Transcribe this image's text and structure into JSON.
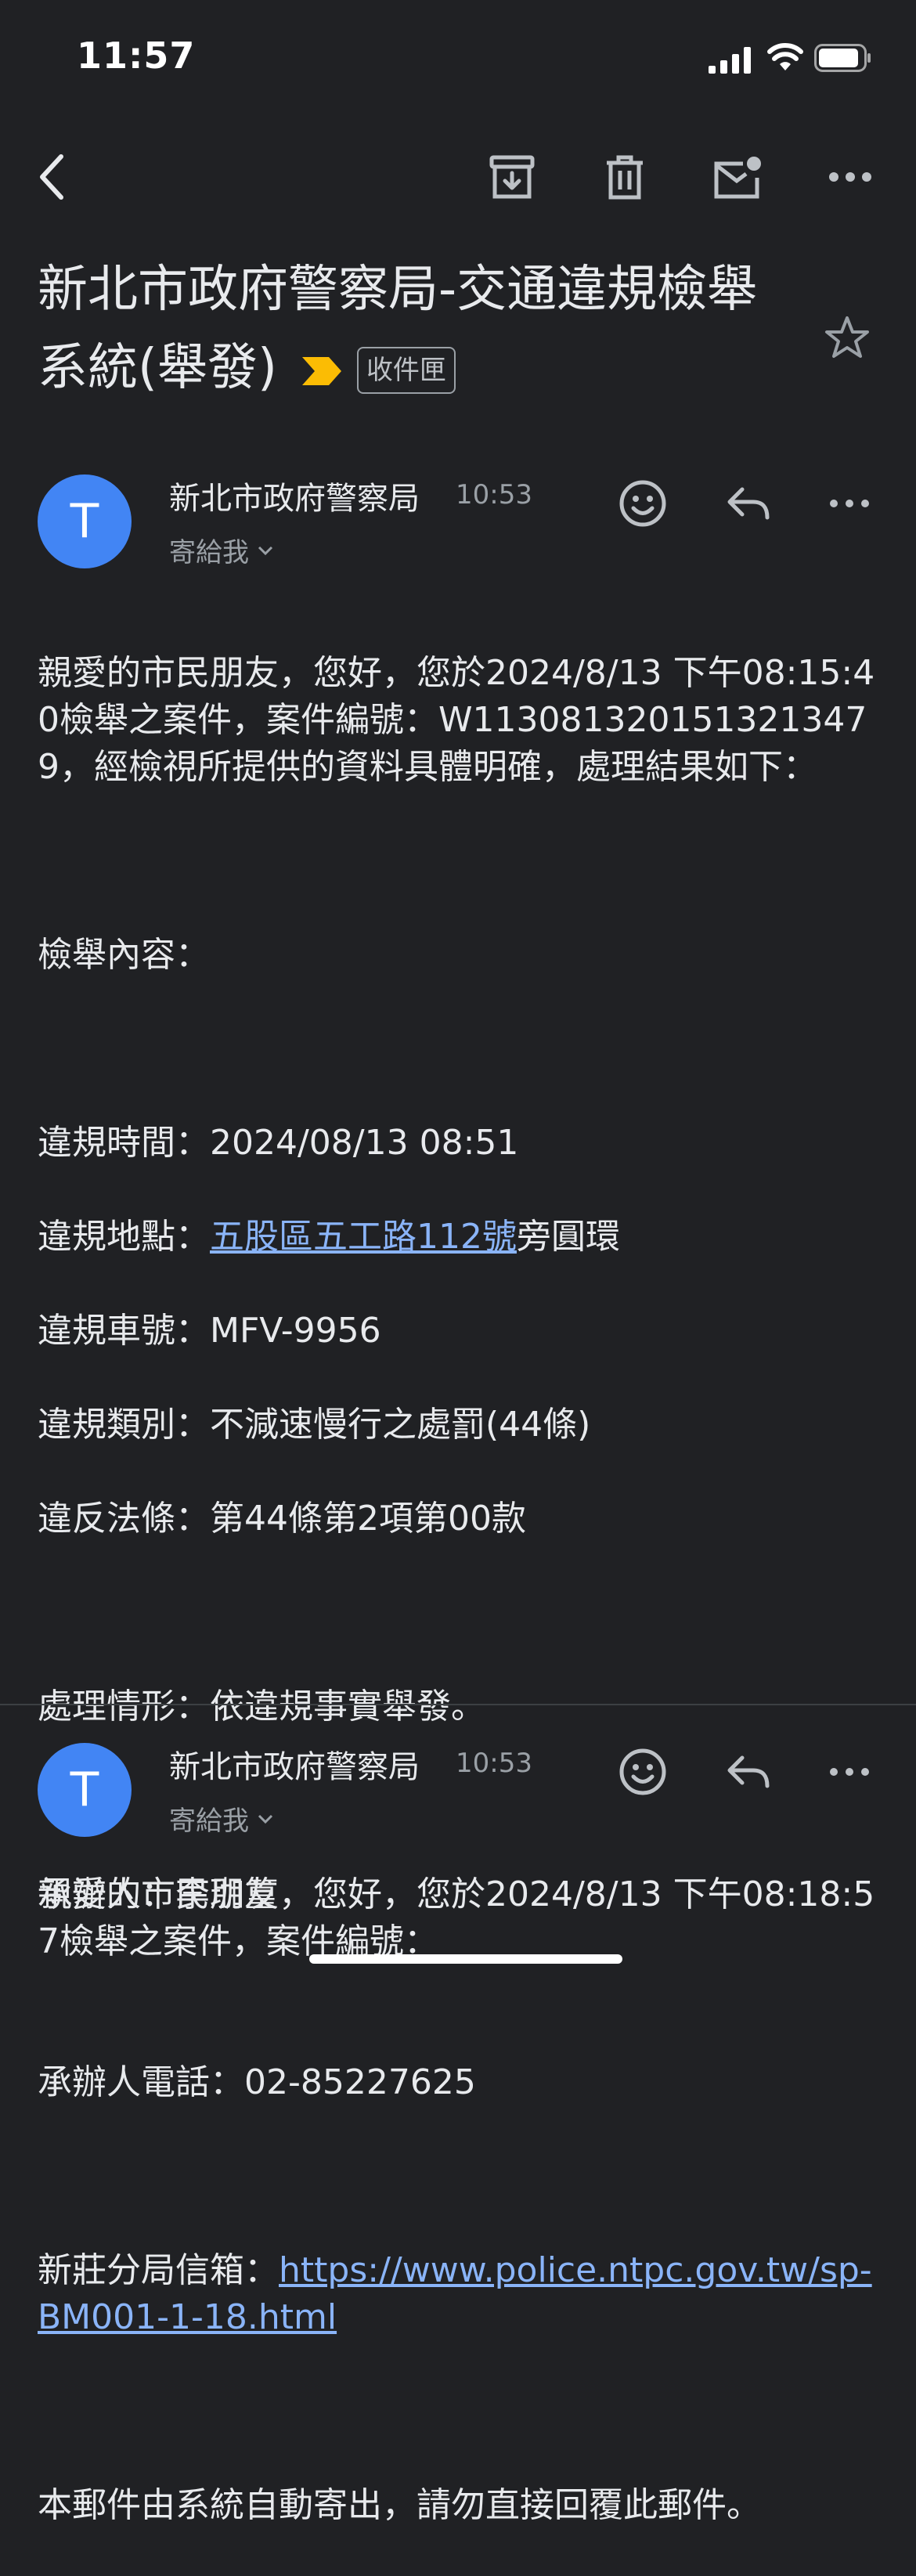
{
  "status": {
    "time": "11:57"
  },
  "subject": {
    "title": "新北市政府警察局-交通違規檢舉系統(舉發)",
    "label": "收件匣"
  },
  "message1": {
    "avatar_letter": "T",
    "sender": "新北市政府警察局",
    "time": "10:53",
    "to": "寄給我",
    "intro": "親愛的市民朋友，您好，您於2024/8/13 下午08:15:40檢舉之案件，案件編號：W1130813201513213479，經檢視所提供的資料具體明確，處理結果如下：",
    "content_header": "檢舉內容：",
    "violation_time": "違規時間：2024/08/13 08:51",
    "location_prefix": "違規地點：",
    "location_link": "五股區五工路112號",
    "location_suffix": "旁圓環",
    "plate": "違規車號：MFV-9956",
    "category": "違規類別：不減速慢行之處罰(44條)",
    "law": "違反法條：第44條第2項第00款",
    "handling": "處理情形：依違規事實舉發。",
    "officer": "承辦人：李珈篁",
    "officer_phone": "承辦人電話：02-85227625",
    "mailbox_prefix": "新莊分局信箱：",
    "mailbox_link": "https://www.police.ntpc.gov.tw/sp-BM001-1-18.html",
    "footer_note": "本郵件由系統自動寄出，請勿直接回覆此郵件。"
  },
  "message2": {
    "avatar_letter": "T",
    "sender": "新北市政府警察局",
    "time": "10:53",
    "to": "寄給我",
    "intro": "親愛的市民朋友，您好，您於2024/8/13 下午08:18:57檢舉之案件，案件編號："
  },
  "colors": {
    "background": "#202124",
    "avatar": "#4285f4",
    "link": "#8ab4f8",
    "important": "#fbbc04"
  }
}
